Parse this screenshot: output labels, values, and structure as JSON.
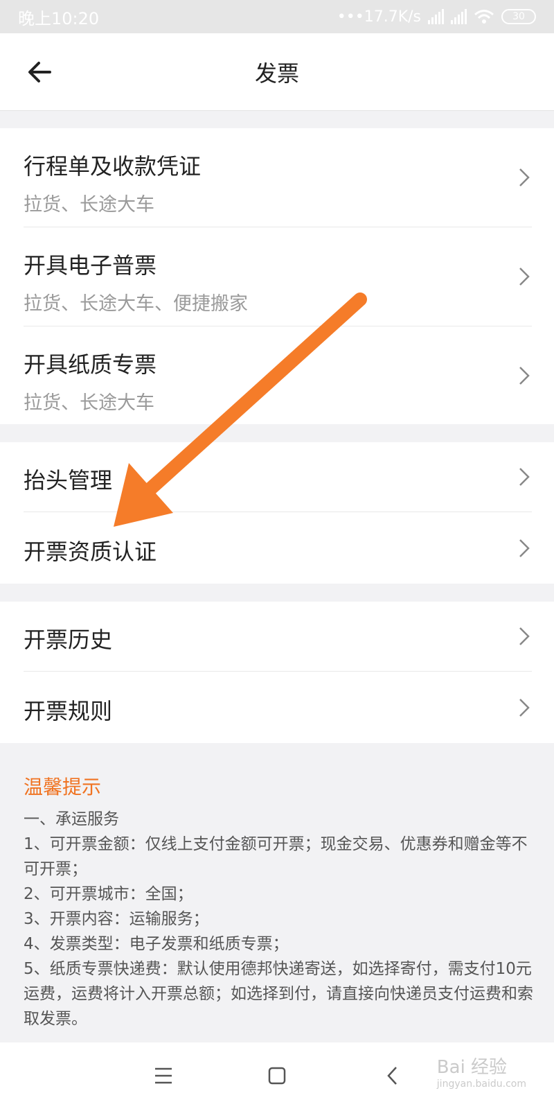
{
  "status_bar": {
    "time": "晚上10:20",
    "network_speed": "•••17.7K/s",
    "battery": "30"
  },
  "header": {
    "title": "发票"
  },
  "groups": [
    {
      "items": [
        {
          "title": "行程单及收款凭证",
          "subtitle": "拉货、长途大车"
        },
        {
          "title": "开具电子普票",
          "subtitle": "拉货、长途大车、便捷搬家"
        },
        {
          "title": "开具纸质专票",
          "subtitle": "拉货、长途大车"
        }
      ]
    },
    {
      "items": [
        {
          "title": "抬头管理"
        },
        {
          "title": "开票资质认证"
        }
      ]
    },
    {
      "items": [
        {
          "title": "开票历史"
        },
        {
          "title": "开票规则"
        }
      ]
    }
  ],
  "tips": {
    "title": "温馨提示",
    "lines": [
      "一、承运服务",
      "1、可开票金额：仅线上支付金额可开票；现金交易、优惠券和赠金等不可开票；",
      "2、可开票城市：全国；",
      "3、开票内容：运输服务；",
      "4、发票类型：电子发票和纸质专票；",
      "5、纸质专票快递费：默认使用德邦快递寄送，如选择寄付，需支付10元运费，运费将计入开票总额；如选择到付，请直接向快递员支付运费和索取发票。"
    ]
  },
  "watermark": {
    "brand": "Bai 经验",
    "url": "jingyan.baidu.com"
  },
  "colors": {
    "accent": "#f07321",
    "arrow": "#f57c29"
  }
}
